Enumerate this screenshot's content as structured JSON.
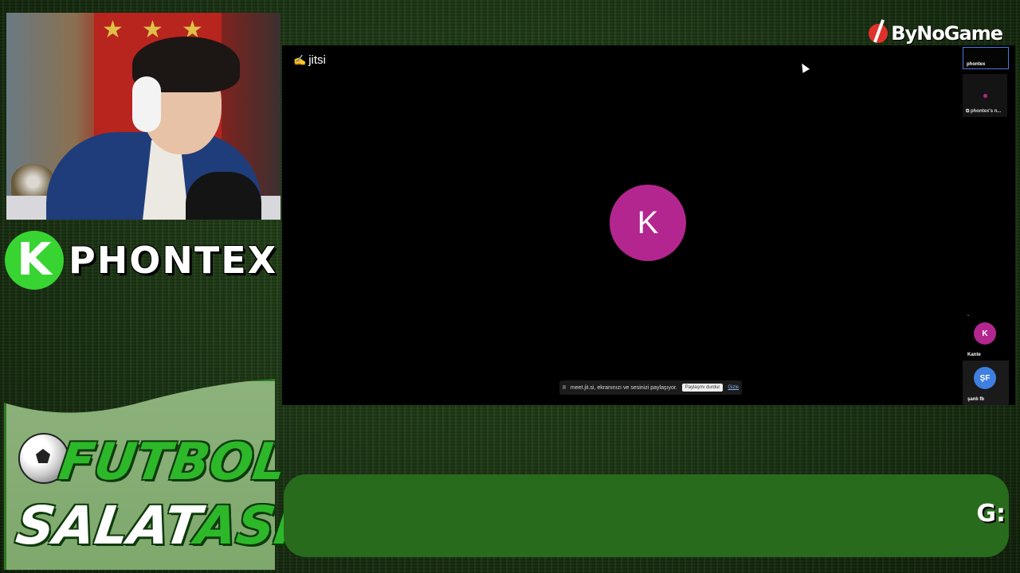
{
  "brand": {
    "name": "ByNoGame"
  },
  "streamer": {
    "badge_letter": "K",
    "name": "PHONTEX"
  },
  "show": {
    "line1": "FUTBOL",
    "line2_main": "SALAT",
    "line2_accent": "ASI"
  },
  "jitsi": {
    "logo": "jitsi",
    "main_avatar_initial": "K",
    "main_avatar_color": "#b3268f",
    "share_bar": {
      "pause_icon": "II",
      "text": "meet.jit.si, ekranınızı ve sesinizi paylaşıyor.",
      "stop_label": "Paylaşmı durdur",
      "hide_label": "Gizle"
    },
    "filmstrip": {
      "self_label": "phontex",
      "share_label": "phontex's n...",
      "participants": [
        {
          "initial": "K",
          "name": "Kante",
          "color": "#b3268f"
        },
        {
          "initial": "ŞF",
          "name": "şanlı fb",
          "color": "#3f7fe0"
        }
      ]
    }
  },
  "ticker": {
    "text": "G:"
  }
}
